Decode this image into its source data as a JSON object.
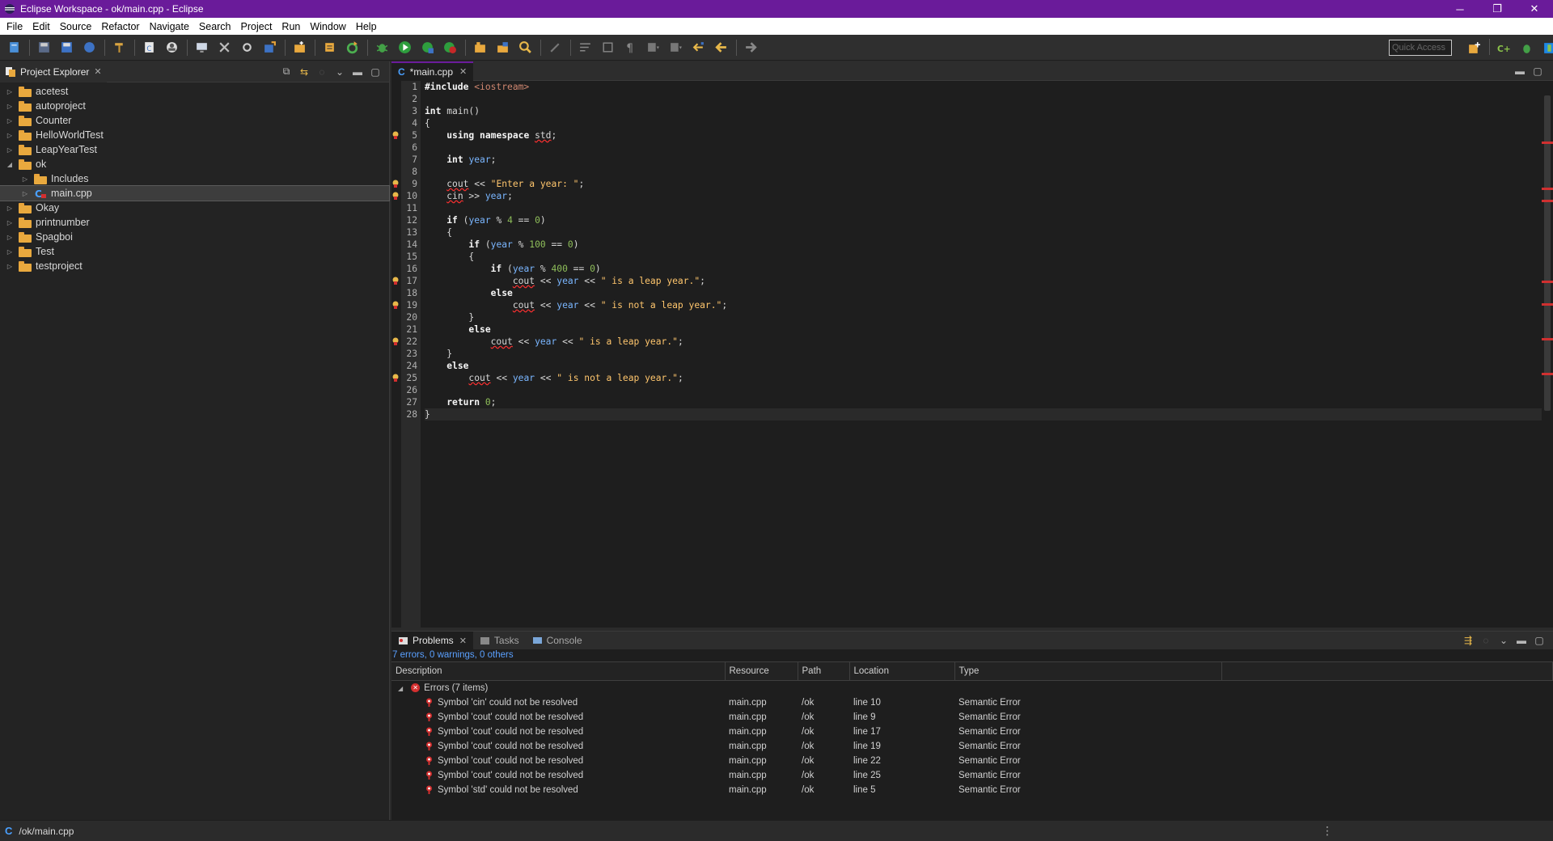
{
  "window": {
    "title": "Eclipse Workspace - ok/main.cpp - Eclipse",
    "min": "─",
    "restore": "❐",
    "close": "✕"
  },
  "menu": [
    "File",
    "Edit",
    "Source",
    "Refactor",
    "Navigate",
    "Search",
    "Project",
    "Run",
    "Window",
    "Help"
  ],
  "quick_access": {
    "placeholder": "Quick Access"
  },
  "explorer": {
    "title": "Project Explorer",
    "items": [
      {
        "label": "acetest",
        "level": 0,
        "expanded": false
      },
      {
        "label": "autoproject",
        "level": 0,
        "expanded": false
      },
      {
        "label": "Counter",
        "level": 0,
        "expanded": false
      },
      {
        "label": "HelloWorldTest",
        "level": 0,
        "expanded": false
      },
      {
        "label": "LeapYearTest",
        "level": 0,
        "expanded": false
      },
      {
        "label": "ok",
        "level": 0,
        "expanded": true
      },
      {
        "label": "Includes",
        "level": 1,
        "expanded": false
      },
      {
        "label": "main.cpp",
        "level": 1,
        "expanded": false,
        "selected": true
      },
      {
        "label": "Okay",
        "level": 0,
        "expanded": false
      },
      {
        "label": "printnumber",
        "level": 0,
        "expanded": false
      },
      {
        "label": "Spagboi",
        "level": 0,
        "expanded": false
      },
      {
        "label": "Test",
        "level": 0,
        "expanded": false
      },
      {
        "label": "testproject",
        "level": 0,
        "expanded": false
      }
    ]
  },
  "editor": {
    "tab_label": "*main.cpp",
    "current_line": 28,
    "error_lines": [
      5,
      9,
      10,
      17,
      19,
      22,
      25
    ],
    "lines": [
      "#include <iostream>",
      "",
      "int main()",
      "{",
      "    using namespace std;",
      "",
      "    int year;",
      "",
      "    cout << \"Enter a year: \";",
      "    cin >> year;",
      "",
      "    if (year % 4 == 0)",
      "    {",
      "        if (year % 100 == 0)",
      "        {",
      "            if (year % 400 == 0)",
      "                cout << year << \" is a leap year.\";",
      "            else",
      "                cout << year << \" is not a leap year.\";",
      "        }",
      "        else",
      "            cout << year << \" is a leap year.\";",
      "    }",
      "    else",
      "        cout << year << \" is not a leap year.\";",
      "",
      "    return 0;",
      "}"
    ]
  },
  "problems": {
    "tabs": [
      "Problems",
      "Tasks",
      "Console"
    ],
    "summary": "7 errors, 0 warnings, 0 others",
    "columns": [
      "Description",
      "Resource",
      "Path",
      "Location",
      "Type"
    ],
    "group": "Errors (7 items)",
    "rows": [
      {
        "description": "Symbol 'cin' could not be resolved",
        "resource": "main.cpp",
        "path": "/ok",
        "location": "line 10",
        "type": "Semantic Error"
      },
      {
        "description": "Symbol 'cout' could not be resolved",
        "resource": "main.cpp",
        "path": "/ok",
        "location": "line 9",
        "type": "Semantic Error"
      },
      {
        "description": "Symbol 'cout' could not be resolved",
        "resource": "main.cpp",
        "path": "/ok",
        "location": "line 17",
        "type": "Semantic Error"
      },
      {
        "description": "Symbol 'cout' could not be resolved",
        "resource": "main.cpp",
        "path": "/ok",
        "location": "line 19",
        "type": "Semantic Error"
      },
      {
        "description": "Symbol 'cout' could not be resolved",
        "resource": "main.cpp",
        "path": "/ok",
        "location": "line 22",
        "type": "Semantic Error"
      },
      {
        "description": "Symbol 'cout' could not be resolved",
        "resource": "main.cpp",
        "path": "/ok",
        "location": "line 25",
        "type": "Semantic Error"
      },
      {
        "description": "Symbol 'std' could not be resolved",
        "resource": "main.cpp",
        "path": "/ok",
        "location": "line 5",
        "type": "Semantic Error"
      }
    ]
  },
  "status": {
    "path": "/ok/main.cpp"
  },
  "colors": {
    "titlebar": "#6a1b9a",
    "error": "#d32f2f",
    "link": "#5aa0ff"
  }
}
